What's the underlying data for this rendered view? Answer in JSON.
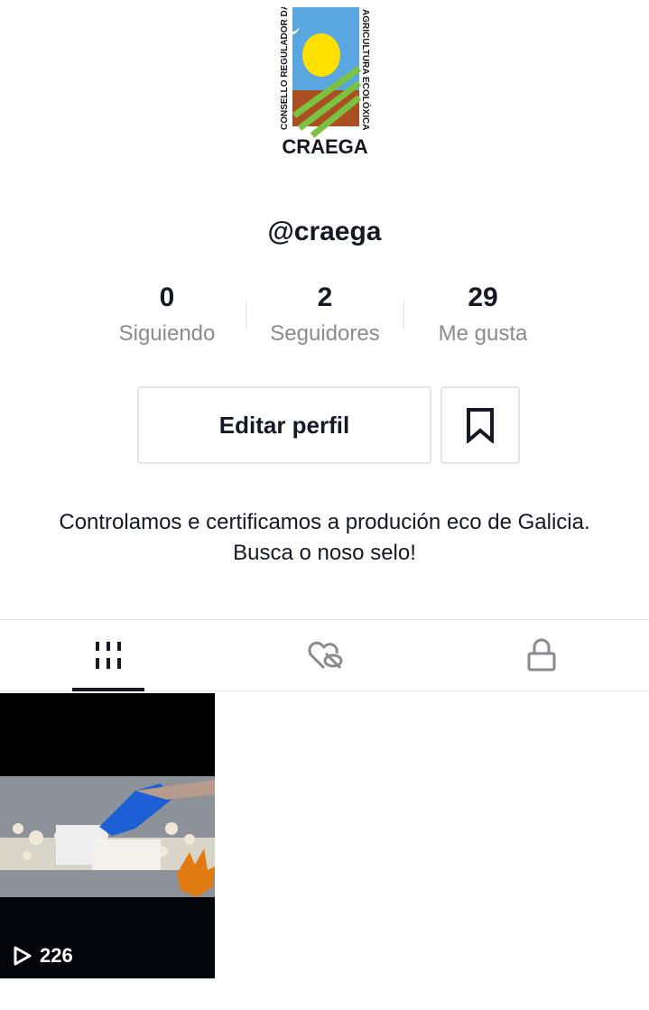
{
  "profile": {
    "logo": {
      "left_text": "CONSELLO REGULADOR DA",
      "right_text": "AGRICULTURA ECOLÓXICA",
      "brand": "CRAEGA"
    },
    "username": "@craega",
    "stats": [
      {
        "value": "0",
        "label": "Siguiendo"
      },
      {
        "value": "2",
        "label": "Seguidores"
      },
      {
        "value": "29",
        "label": "Me gusta"
      }
    ],
    "edit_button": "Editar perfil",
    "bio": "Controlamos e certificamos a produción eco de Galicia. Busca o noso selo!"
  },
  "tabs": [
    {
      "icon": "videos-grid-icon",
      "active": true
    },
    {
      "icon": "liked-hidden-icon",
      "active": false
    },
    {
      "icon": "private-lock-icon",
      "active": false
    }
  ],
  "videos": [
    {
      "views": "226"
    }
  ],
  "colors": {
    "text": "#161823",
    "secondary_text": "#8a8b91",
    "border": "#e3e3e4",
    "logo_blue": "#5aa6e0",
    "logo_sun": "#ffe100",
    "logo_soil": "#a94f22",
    "logo_green": "#7cc242"
  }
}
